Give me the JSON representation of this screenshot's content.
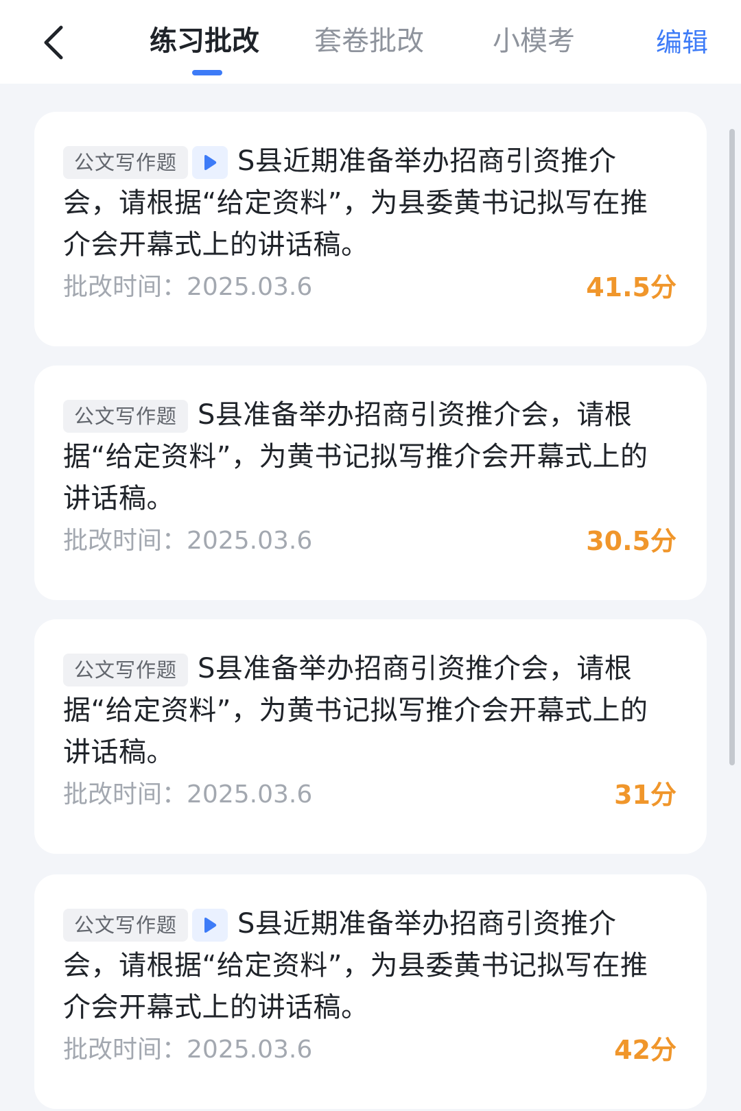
{
  "header": {
    "tabs": [
      {
        "label": "练习批改",
        "active": true
      },
      {
        "label": "套卷批改",
        "active": false
      },
      {
        "label": "小模考",
        "active": false
      }
    ],
    "edit_label": "编辑",
    "accent_color": "#3d7bf7"
  },
  "cards": [
    {
      "tag": "公文写作题",
      "has_video": true,
      "title": "S县近期准备举办招商引资推介会，请根据“给定资料”，为县委黄书记拟写在推介会开幕式上的讲话稿。",
      "time_label": "批改时间：",
      "time": "2025.03.6",
      "score": "41.5分"
    },
    {
      "tag": "公文写作题",
      "has_video": false,
      "title": "S县准备举办招商引资推介会，请根据“给定资料”，为黄书记拟写推介会开幕式上的讲话稿。",
      "time_label": "批改时间：",
      "time": "2025.03.6",
      "score": "30.5分"
    },
    {
      "tag": "公文写作题",
      "has_video": false,
      "title": "S县准备举办招商引资推介会，请根据“给定资料”，为黄书记拟写推介会开幕式上的讲话稿。",
      "time_label": "批改时间：",
      "time": "2025.03.6",
      "score": "31分"
    },
    {
      "tag": "公文写作题",
      "has_video": true,
      "title": "S县近期准备举办招商引资推介会，请根据“给定资料”，为县委黄书记拟写在推介会开幕式上的讲话稿。",
      "time_label": "批改时间：",
      "time": "2025.03.6",
      "score": "42分"
    }
  ],
  "score_color": "#f0962b"
}
